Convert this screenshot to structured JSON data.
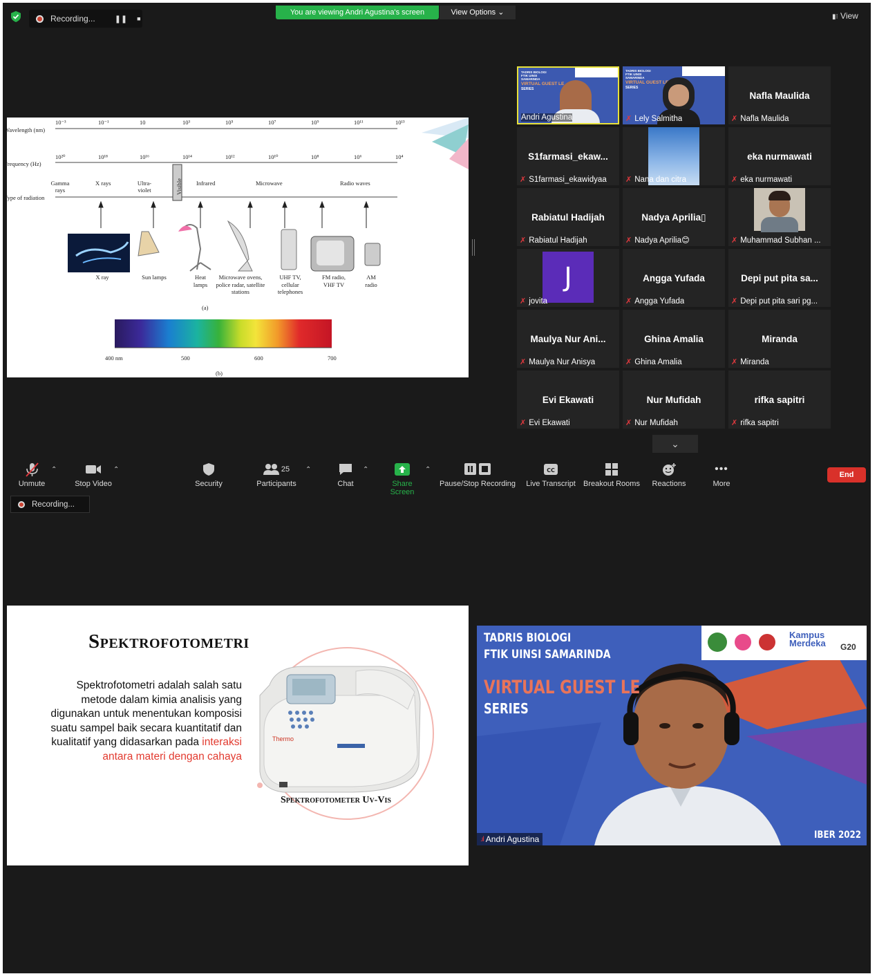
{
  "top_bar": {
    "recording_label": "Recording...",
    "viewing_banner": "You are viewing Andri Agustina's screen",
    "view_options": "View Options",
    "view_label": "View"
  },
  "slide1": {
    "wavelength_label": "Wavelength (nm)",
    "frequency_label": "Frequency (Hz)",
    "radiation_label": "Type of radiation",
    "wavelength_ticks": [
      "10⁻³",
      "10⁻¹",
      "10",
      "10³",
      "10⁵",
      "10⁷",
      "10⁹",
      "10¹¹",
      "10¹³"
    ],
    "frequency_ticks": [
      "10²⁰",
      "10¹⁸",
      "10¹⁶",
      "10¹⁴",
      "10¹²",
      "10¹⁰",
      "10⁸",
      "10⁶",
      "10⁴"
    ],
    "radiation_types": [
      "Gamma rays",
      "X rays",
      "Ultra-violet",
      "Visible",
      "Infrared",
      "Microwave",
      "Radio waves"
    ],
    "devices": [
      "X ray",
      "Sun lamps",
      "Heat lamps",
      "Microwave ovens, police radar, satellite stations",
      "UHF TV, cellular telephones",
      "FM radio, VHF TV",
      "AM radio"
    ],
    "caption_a": "(a)",
    "spectrum_ticks": [
      "400 nm",
      "500",
      "600",
      "700"
    ],
    "caption_b": "(b)"
  },
  "gallery": [
    {
      "name": "",
      "label": "Andri Agustina",
      "video": true,
      "active": true
    },
    {
      "name": "",
      "label": "Lely Salmitha",
      "video": true
    },
    {
      "name": "Nafla Maulida",
      "label": "Nafla Maulida"
    },
    {
      "name": "S1farmasi_ekaw...",
      "label": "S1farmasi_ekawidyaa"
    },
    {
      "name": "",
      "label": "Nana dan citra",
      "video": true
    },
    {
      "name": "eka nurmawati",
      "label": "eka nurmawati"
    },
    {
      "name": "Rabiatul Hadijah",
      "label": "Rabiatul Hadijah"
    },
    {
      "name": "Nadya Aprilia▯",
      "label": "Nadya Aprilia😊"
    },
    {
      "name": "",
      "label": "Muhammad Subhan ...",
      "video": true
    },
    {
      "name": "J",
      "label": "jovita",
      "avatar": true
    },
    {
      "name": "Angga Yufada",
      "label": "Angga Yufada"
    },
    {
      "name": "Depi put pita sa...",
      "label": "Depi put pita sari pg..."
    },
    {
      "name": "Maulya Nur Ani...",
      "label": "Maulya Nur Anisya"
    },
    {
      "name": "Ghina Amalia",
      "label": "Ghina Amalia"
    },
    {
      "name": "Miranda",
      "label": "Miranda"
    },
    {
      "name": "Evi Ekawati",
      "label": "Evi Ekawati"
    },
    {
      "name": "Nur Mufidah",
      "label": "Nur Mufidah"
    },
    {
      "name": "rifka sapitri",
      "label": "rifka sapitri"
    }
  ],
  "thumb_text": {
    "small_header": "TADRIS BIOLOGI FTIK UINSI SAMARINDA",
    "small_title": "VIRTUAL GUEST LE",
    "small_title2": "VIRTUAL GUEST LECTURE",
    "series": "SERIES"
  },
  "toolbar": {
    "unmute": "Unmute",
    "stop_video": "Stop Video",
    "security": "Security",
    "participants": "Participants",
    "participants_count": "25",
    "chat": "Chat",
    "share_screen": "Share Screen",
    "pause_recording": "Pause/Stop Recording",
    "live_transcript": "Live Transcript",
    "breakout_rooms": "Breakout Rooms",
    "reactions": "Reactions",
    "more": "More",
    "end": "End",
    "recording_label": "Recording..."
  },
  "slide2": {
    "title": "Spektrofotometri",
    "body_plain": "Spektrofotometri adalah salah satu metode dalam kimia analisis yang digunakan untuk menentukan komposisi suatu sampel baik secara kuantitatif dan kualitatif yang didasarkan pada",
    "body_highlight": "interaksi antara materi dengan cahaya",
    "device_caption": "Spektrofotometer Uv-Vis",
    "brand": "Thermo"
  },
  "speaker": {
    "header1": "TADRIS BIOLOGI",
    "header2": "FTIK UINSI SAMARINDA",
    "title": "VIRTUAL GUEST LE",
    "series": "SERIES",
    "logo_text": "Kampus Merdeka",
    "g20": "G20",
    "corner": "IBER 2022",
    "name": "Andri Agustina"
  },
  "colors": {
    "accent_green": "#27b24a",
    "end_red": "#d9312a",
    "highlight_red": "#e23a2f",
    "active_border": "#e8e23a"
  }
}
